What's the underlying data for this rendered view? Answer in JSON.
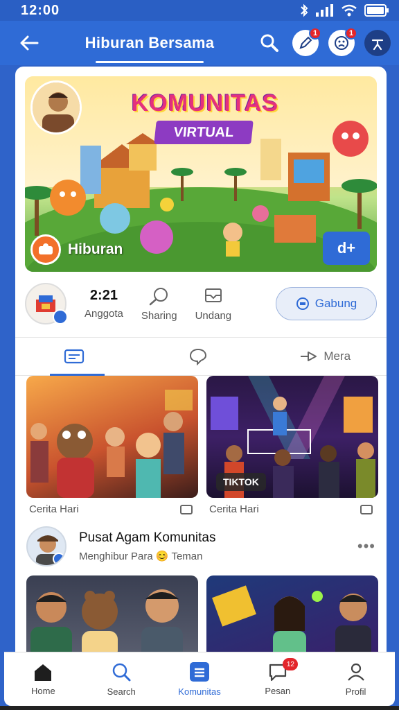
{
  "status_bar": {
    "time": "12:00",
    "icons": [
      "bluetooth-icon",
      "signal-icon",
      "wifi-icon",
      "battery-icon"
    ]
  },
  "header": {
    "title": "Hiburan Bersama",
    "notification_badge_1": "1",
    "notification_badge_2": "1"
  },
  "hero": {
    "title": "KOMUNITAS",
    "banner": "VIRTUAL",
    "channel_name": "Hiburan",
    "cta_label": "d+"
  },
  "stats": {
    "count_value": "2:21",
    "count_label": "Anggota",
    "stat2_label": "Sharing",
    "stat3_label": "Undang",
    "join_label": "Gabung"
  },
  "tabs": [
    {
      "label": ""
    },
    {
      "label": ""
    },
    {
      "label": "Mera"
    }
  ],
  "feed": {
    "thumb1_caption": "Cerita Hari",
    "thumb2_caption": "Cerita Hari",
    "thumb2_badge": "TIKTOK"
  },
  "post": {
    "title": "Pusat Agam Komunitas",
    "subtitle": "Menghibur Para 😊 Teman"
  },
  "navbar": {
    "items": [
      {
        "label": "Home"
      },
      {
        "label": "Search"
      },
      {
        "label": "Komunitas"
      },
      {
        "label": "Pesan",
        "badge": "12"
      },
      {
        "label": "Profil"
      }
    ]
  },
  "colors": {
    "primary": "#2f6bd6",
    "status_bar": "#2a5fc4",
    "badge_red": "#e3262b"
  }
}
